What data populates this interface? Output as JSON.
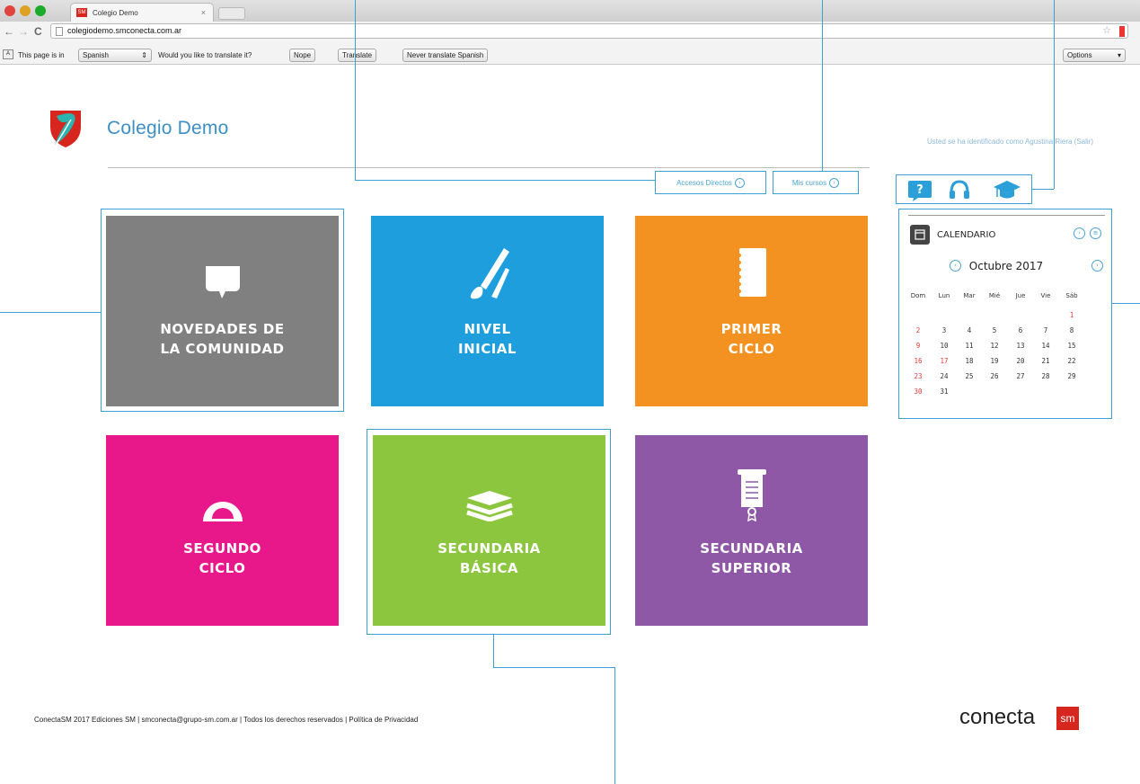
{
  "browser": {
    "tab_title": "Colegio Demo",
    "tab_close": "×",
    "favicon_text": "SM",
    "url": "colegiodemo.smconecta.com.ar",
    "back": "←",
    "forward": "→",
    "reload": "C",
    "star": "☆"
  },
  "translate_bar": {
    "page_is_in": "This page is in",
    "language": "Spanish",
    "language_arrow": "⇕",
    "question": "Would you like to translate it?",
    "nope": "Nope",
    "translate": "Translate",
    "never": "Never translate Spanish",
    "options": "Options",
    "options_arrow": "▾",
    "icon_text": "A"
  },
  "header": {
    "brand": "Colegio Demo",
    "user_line": "Usted se ha identificado como Agustina Riera (Salir)"
  },
  "shortcuts": {
    "accesos": "Accesos Directos",
    "mis_cursos": "Mis cursos",
    "arrow": "›"
  },
  "tiles": [
    {
      "line1": "NOVEDADES DE",
      "line2": "LA COMUNIDAD",
      "color": "#808080"
    },
    {
      "line1": "NIVEL",
      "line2": "INICIAL",
      "color": "#1f9ede"
    },
    {
      "line1": "PRIMER",
      "line2": "CICLO",
      "color": "#f39221"
    },
    {
      "line1": "SEGUNDO",
      "line2": "CICLO",
      "color": "#e8188b"
    },
    {
      "line1": "SECUNDARIA",
      "line2": "BÁSICA",
      "color": "#8cc63e"
    },
    {
      "line1": "SECUNDARIA",
      "line2": "SUPERIOR",
      "color": "#8e58a6"
    }
  ],
  "calendar": {
    "title": "CALENDARIO",
    "month": "Octubre 2017",
    "prev": "‹",
    "next": "›",
    "ctl_play": "›",
    "ctl_more": "≡",
    "weekdays": [
      "Dom",
      "Lun",
      "Mar",
      "Mié",
      "Jue",
      "Vie",
      "Sáb"
    ],
    "weeks": [
      [
        "",
        "",
        "",
        "",
        "",
        "",
        "1"
      ],
      [
        "2",
        "3",
        "4",
        "5",
        "6",
        "7",
        "8"
      ],
      [
        "9",
        "10",
        "11",
        "12",
        "13",
        "14",
        "15"
      ],
      [
        "16",
        "17",
        "18",
        "19",
        "20",
        "21",
        "22"
      ],
      [
        "23",
        "24",
        "25",
        "26",
        "27",
        "28",
        "29"
      ],
      [
        "30",
        "31",
        "",
        "",
        "",
        "",
        ""
      ]
    ],
    "red_color": "#e03b3b"
  },
  "footer": {
    "text": "ConectaSM 2017 Ediciones SM | smconecta@grupo-sm.com.ar | Todos los derechos reservados | Política de Privacidad",
    "logo_text": "conecta",
    "logo_badge": "sm"
  },
  "colors": {
    "accent": "#3ba0d6",
    "brand_text": "#3d8fc4"
  }
}
